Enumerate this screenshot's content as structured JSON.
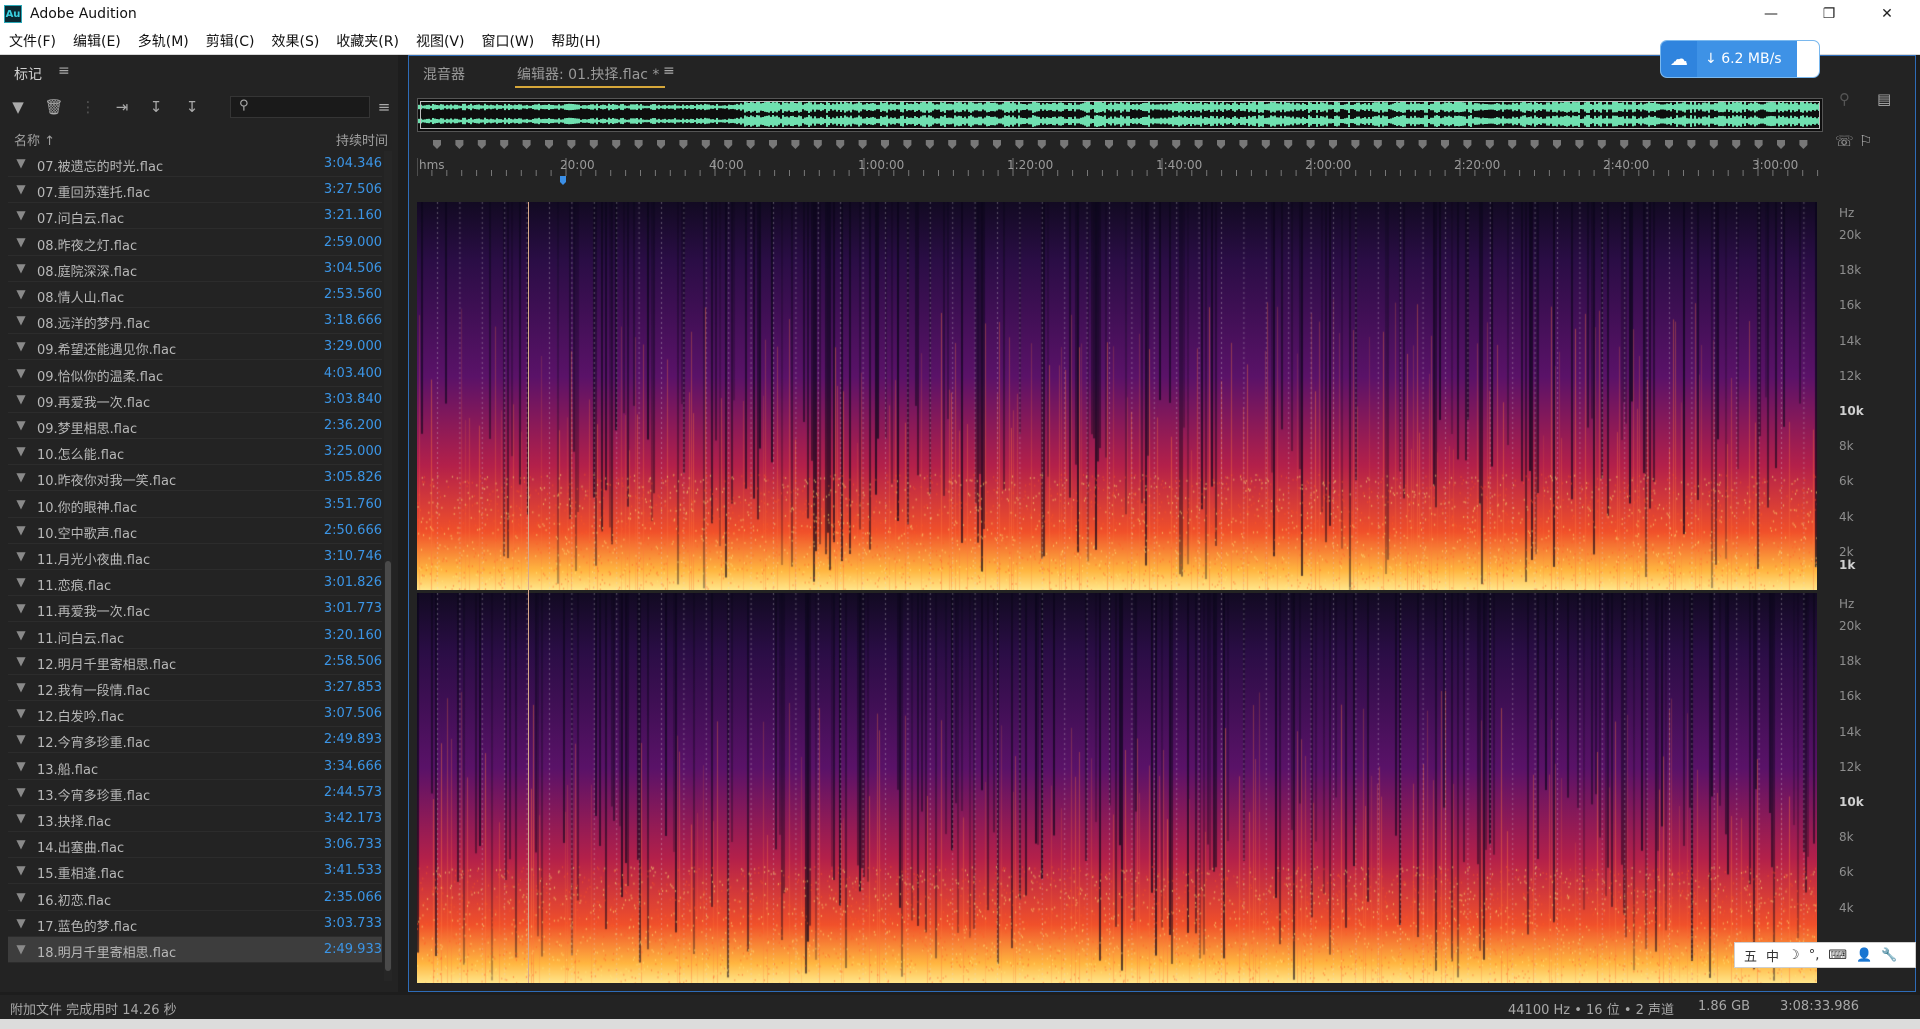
{
  "window": {
    "app_icon_text": "Au",
    "title": "Adobe Audition"
  },
  "menu": [
    "文件(F)",
    "编辑(E)",
    "多轨(M)",
    "剪辑(C)",
    "效果(S)",
    "收藏夹(R)",
    "视图(V)",
    "窗口(W)",
    "帮助(H)"
  ],
  "markers_panel": {
    "tab_label": "标记",
    "columns": {
      "name": "名称",
      "duration": "持续时间"
    },
    "items": [
      {
        "name": "07.被遗忘的时光.flac",
        "duration": "3:04.346"
      },
      {
        "name": "07.重回苏莲托.flac",
        "duration": "3:27.506"
      },
      {
        "name": "07.问白云.flac",
        "duration": "3:21.160"
      },
      {
        "name": "08.昨夜之灯.flac",
        "duration": "2:59.000"
      },
      {
        "name": "08.庭院深深.flac",
        "duration": "3:04.506"
      },
      {
        "name": "08.情人山.flac",
        "duration": "2:53.560"
      },
      {
        "name": "08.远洋的梦丹.flac",
        "duration": "3:18.666"
      },
      {
        "name": "09.希望还能遇见你.flac",
        "duration": "3:29.000"
      },
      {
        "name": "09.恰似你的温柔.flac",
        "duration": "4:03.400"
      },
      {
        "name": "09.再爱我一次.flac",
        "duration": "3:03.840"
      },
      {
        "name": "09.梦里相思.flac",
        "duration": "2:36.200"
      },
      {
        "name": "10.怎么能.flac",
        "duration": "3:25.000"
      },
      {
        "name": "10.昨夜你对我一笑.flac",
        "duration": "3:05.826"
      },
      {
        "name": "10.你的眼神.flac",
        "duration": "3:51.760"
      },
      {
        "name": "10.空中歌声.flac",
        "duration": "2:50.666"
      },
      {
        "name": "11.月光小夜曲.flac",
        "duration": "3:10.746"
      },
      {
        "name": "11.恋痕.flac",
        "duration": "3:01.826"
      },
      {
        "name": "11.再爱我一次.flac",
        "duration": "3:01.773"
      },
      {
        "name": "11.问白云.flac",
        "duration": "3:20.160"
      },
      {
        "name": "12.明月千里寄相思.flac",
        "duration": "2:58.506"
      },
      {
        "name": "12.我有一段情.flac",
        "duration": "3:27.853"
      },
      {
        "name": "12.白发吟.flac",
        "duration": "3:07.506"
      },
      {
        "name": "12.今宵多珍重.flac",
        "duration": "2:49.893"
      },
      {
        "name": "13.船.flac",
        "duration": "3:34.666"
      },
      {
        "name": "13.今宵多珍重.flac",
        "duration": "2:44.573"
      },
      {
        "name": "13.抉择.flac",
        "duration": "3:42.173"
      },
      {
        "name": "14.出塞曲.flac",
        "duration": "3:06.733"
      },
      {
        "name": "15.重相逢.flac",
        "duration": "3:41.533"
      },
      {
        "name": "16.初恋.flac",
        "duration": "2:35.066"
      },
      {
        "name": "17.蓝色的梦.flac",
        "duration": "3:03.733"
      },
      {
        "name": "18.明月千里寄相思.flac",
        "duration": "2:49.933",
        "selected": true
      }
    ]
  },
  "editor": {
    "tab_mixer": "混音器",
    "tab_editor": "编辑器: 01.抉择.flac *",
    "ruler_unit": "hms",
    "ruler_ticks": [
      "20:00",
      "40:00",
      "1:00:00",
      "1:20:00",
      "1:40:00",
      "2:00:00",
      "2:20:00",
      "2:40:00",
      "3:00:00"
    ],
    "hz_unit": "Hz",
    "hz_labels": [
      "20k",
      "18k",
      "16k",
      "14k",
      "12k",
      "10k",
      "8k",
      "6k",
      "4k",
      "2k",
      "1k"
    ],
    "hz_labels_ch2": [
      "20k",
      "18k",
      "16k",
      "14k",
      "12k",
      "10k",
      "8k",
      "6k",
      "4k"
    ]
  },
  "network": {
    "speed": "6.2 MB/s"
  },
  "ime": [
    "五",
    "中",
    "☽",
    "°,",
    "⌨",
    "👤",
    "🔧"
  ],
  "status": {
    "message": "附加文件 完成用时 14.26 秒",
    "sample_info": "44100 Hz • 16 位 • 2 声道",
    "size": "1.86 GB",
    "duration": "3:08:33.986"
  }
}
